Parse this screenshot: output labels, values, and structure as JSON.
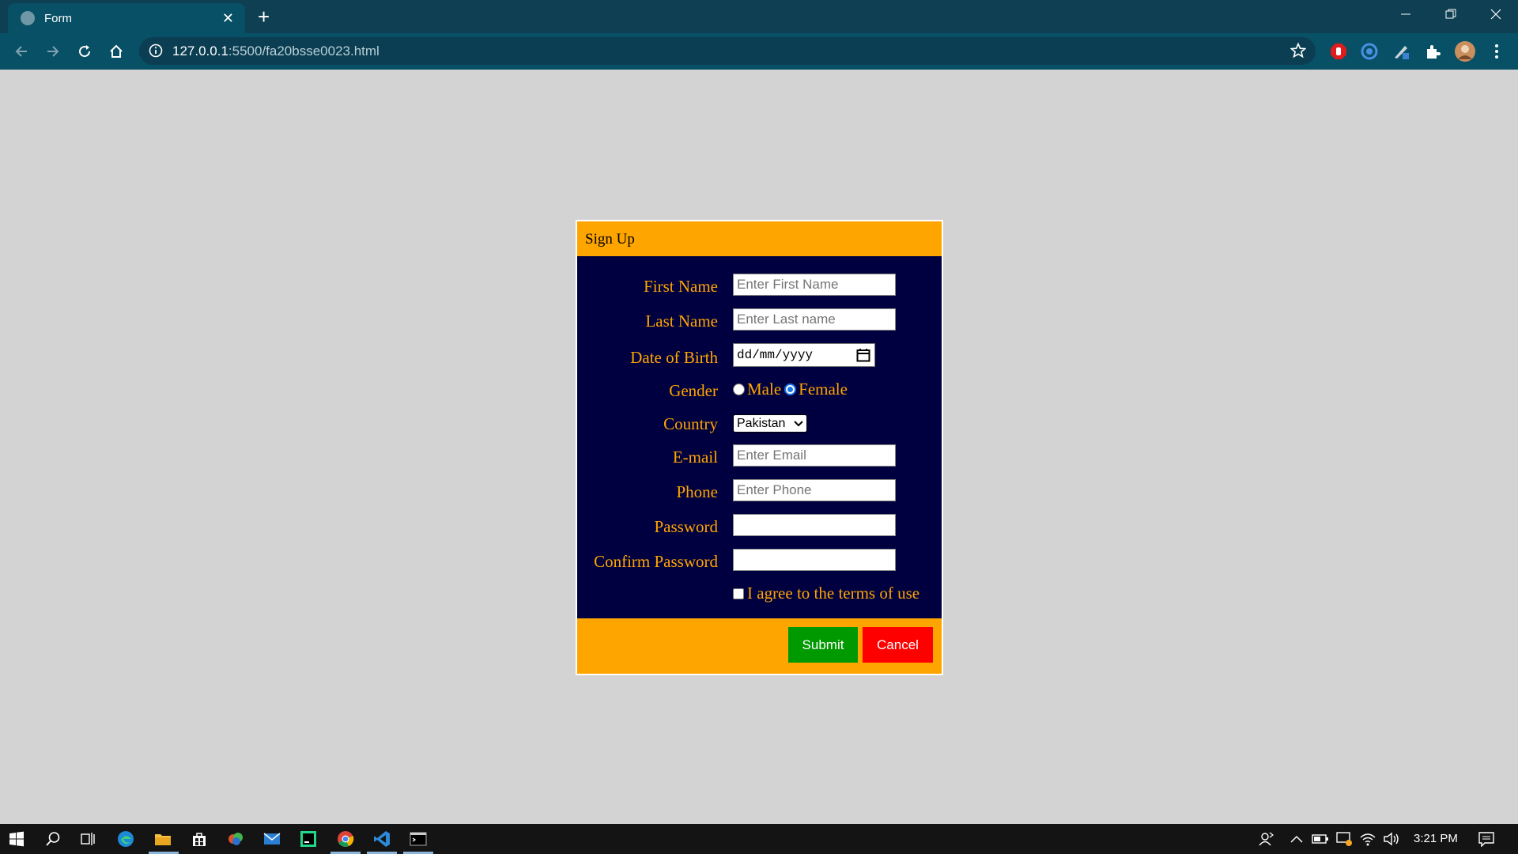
{
  "browser": {
    "tab_title": "Form",
    "new_tab_label": "+",
    "url_host": "127.0.0.1",
    "url_path": ":5500/fa20bsse0023.html"
  },
  "form": {
    "header": "Sign Up",
    "fields": {
      "first_name": {
        "label": "First Name",
        "placeholder": "Enter First Name"
      },
      "last_name": {
        "label": "Last Name",
        "placeholder": "Enter Last name"
      },
      "dob": {
        "label": "Date of Birth",
        "placeholder": "dd/mm/yyyy"
      },
      "gender": {
        "label": "Gender",
        "options": [
          "Male",
          "Female"
        ],
        "selected": "Female"
      },
      "country": {
        "label": "Country",
        "value": "Pakistan"
      },
      "email": {
        "label": "E-mail",
        "placeholder": "Enter Email"
      },
      "phone": {
        "label": "Phone",
        "placeholder": "Enter Phone"
      },
      "password": {
        "label": "Password",
        "placeholder": ""
      },
      "confirm_password": {
        "label": "Confirm Password",
        "placeholder": ""
      }
    },
    "terms_label": "I agree to the terms of use",
    "submit_label": "Submit",
    "cancel_label": "Cancel"
  },
  "taskbar": {
    "time": "3:21 PM"
  },
  "colors": {
    "form_background": "#000040",
    "accent_orange": "#ffa500",
    "submit_green": "#009900",
    "cancel_red": "#ff0000",
    "page_background": "#d3d3d3"
  }
}
